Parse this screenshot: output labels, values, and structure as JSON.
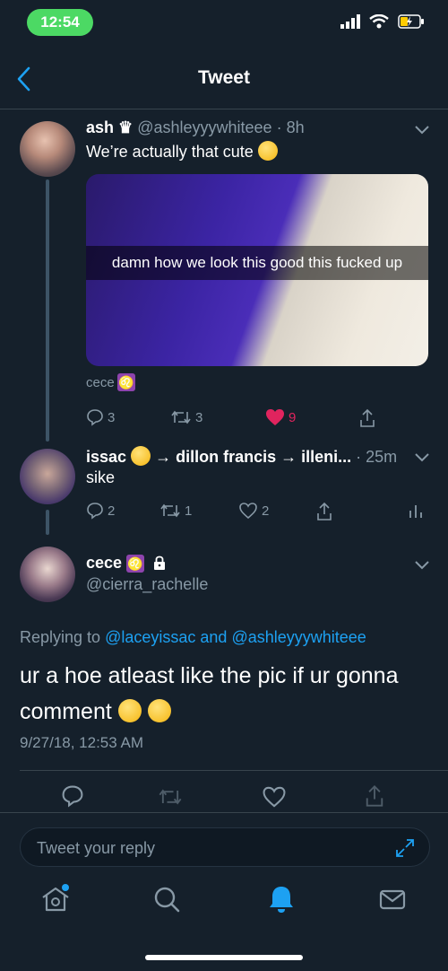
{
  "status": {
    "time": "12:54"
  },
  "nav": {
    "title": "Tweet"
  },
  "tweet1": {
    "name": "ash",
    "crown": "♛",
    "handle": "@ashleyyywhiteee",
    "sep": "·",
    "age": "8h",
    "text": "We’re actually that cute",
    "image_caption": "damn how we look this good this fucked up",
    "tag_name": "cece",
    "zodiac": "♌",
    "reply_count": "3",
    "retweet_count": "3",
    "like_count": "9"
  },
  "tweet2": {
    "name": "issac",
    "header_rest": "→ dillon francis → illeni...",
    "sep": "·",
    "age": "25m",
    "text": "sike",
    "reply_count": "2",
    "retweet_count": "1",
    "like_count": "2"
  },
  "tweet3": {
    "name": "cece",
    "zodiac": "♌",
    "handle": "@cierra_rachelle",
    "replying_prefix": "Replying to",
    "replying_user1": "@laceyissac",
    "replying_and": "and",
    "replying_user2": "@ashleyyywhiteee",
    "text": "ur a hoe atleast like the pic if ur gonna comment",
    "timestamp": "9/27/18, 12:53 AM"
  },
  "reply": {
    "placeholder": "Tweet your reply"
  },
  "tabs": [
    "home",
    "search",
    "notifications",
    "messages"
  ],
  "colors": {
    "background": "#15202b",
    "accent": "#1da1f2",
    "like": "#e0245e",
    "time_pill": "#4cd964"
  }
}
